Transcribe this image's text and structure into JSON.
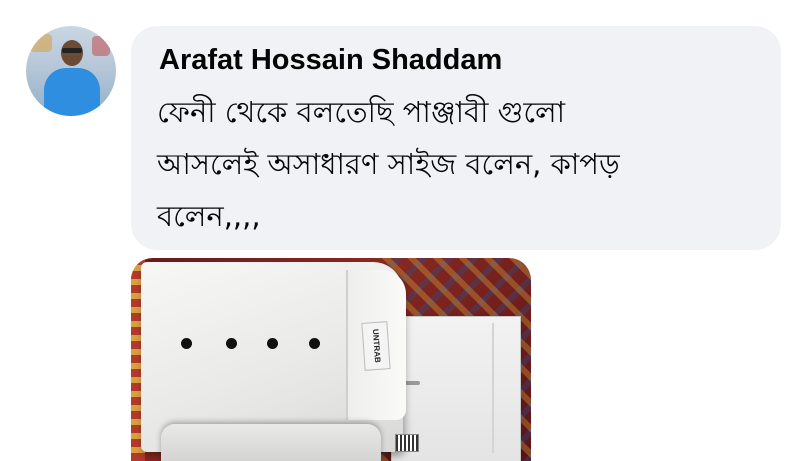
{
  "comment": {
    "author": "Arafat Hossain Shaddam",
    "lines": [
      "ফেনী থেকে বলতেছি পাঞ্জাবী গুলো",
      "আসলেই অসাধারণ সাইজ বলেন, কাপড়",
      "বলেন,,,,"
    ]
  },
  "attachment": {
    "tag_text": "UNTRAB"
  }
}
